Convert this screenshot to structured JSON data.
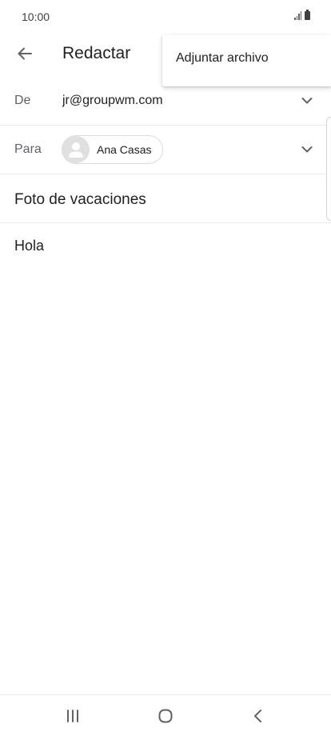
{
  "status_bar": {
    "time": "10:00"
  },
  "app_bar": {
    "title": "Redactar",
    "back_icon": "arrow-left-icon"
  },
  "overflow_menu": {
    "items": [
      {
        "label": "Adjuntar archivo"
      }
    ]
  },
  "compose": {
    "from": {
      "label": "De",
      "value": "jr@groupwm.com"
    },
    "to": {
      "label": "Para",
      "recipient": "Ana Casas"
    },
    "subject": "Foto de vacaciones",
    "body": "Hola"
  },
  "nav_bar": {
    "icons": [
      "recent-apps-icon",
      "home-icon",
      "back-icon"
    ]
  },
  "colors": {
    "text_primary": "#202124",
    "text_secondary": "#5f6368",
    "divider": "#ececec",
    "chip_border": "#dadce0"
  }
}
